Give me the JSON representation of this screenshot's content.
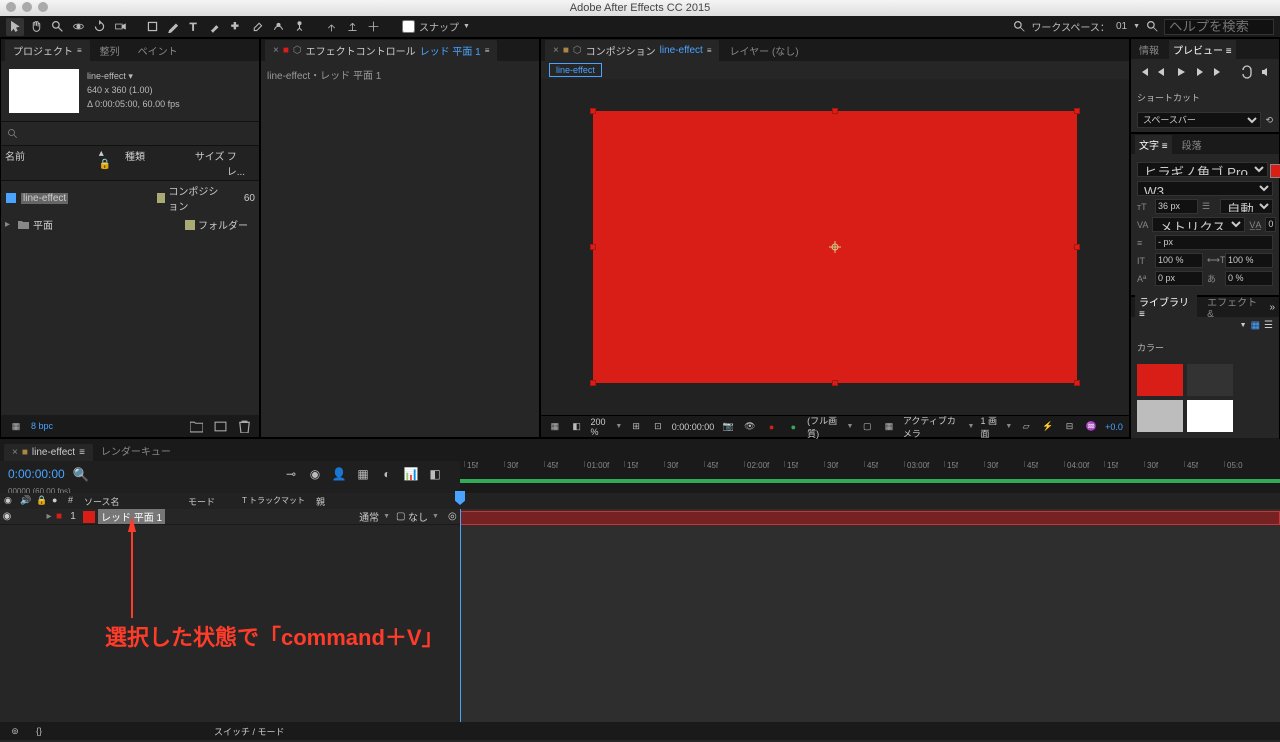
{
  "app": {
    "title": "Adobe After Effects CC 2015"
  },
  "toolbar": {
    "snap_label": "スナップ",
    "workspace_label": "ワークスペース：",
    "workspace_value": "01",
    "search_placeholder": "ヘルプを検索"
  },
  "project": {
    "tab": "プロジェクト",
    "tab2": "整列",
    "tab3": "ペイント",
    "comp_name": "line-effect",
    "comp_dims": "640 x 360 (1.00)",
    "comp_dur": "Δ 0:00:05:00, 60.00 fps",
    "col_name": "名前",
    "col_type": "種類",
    "col_size": "サイズ",
    "col_fre": "フレ...",
    "rows": [
      {
        "name": "line-effect",
        "type": "コンポジション",
        "size": "60"
      },
      {
        "name": "平面",
        "type": "フォルダー",
        "size": ""
      }
    ],
    "bpc": "8 bpc"
  },
  "effect": {
    "tab": "エフェクトコントロール",
    "layer": "レッド 平面 1",
    "path": "line-effect・レッド 平面 1"
  },
  "comp": {
    "tab_prefix": "コンポジション",
    "name": "line-effect",
    "tab_layer": "レイヤー (なし)",
    "chip": "line-effect",
    "zoom": "200 %",
    "time": "0:00:00:00",
    "res": "(フル画質)",
    "camera": "アクティブカメラ",
    "view": "1 画面",
    "offset": "+0.0"
  },
  "right": {
    "info_tab": "情報",
    "preview_tab": "プレビュー",
    "shortcut_label": "ショートカット",
    "shortcut_value": "スペースバー",
    "char_tab": "文字",
    "para_tab": "段落",
    "font": "ヒラギノ角ゴ Pro",
    "font_weight": "W3",
    "font_size": "36 px",
    "leading": "自動",
    "kerning": "メトリクス",
    "tracking": "0",
    "line_spacing": "- px",
    "hscale": "100 %",
    "vscale": "100 %",
    "baseline": "0 px",
    "ratio": "0 %",
    "lib_tab": "ライブラリ",
    "fx_tab": "エフェクト&",
    "colors_label": "カラー",
    "colors": [
      "#d91e18",
      "#333333",
      "#bdbdbd",
      "#ffffff"
    ]
  },
  "timeline": {
    "tab": "line-effect",
    "tab2": "レンダーキュー",
    "time": "0:00:00:00",
    "frame_label": "00000 (60.00 fps)",
    "col_source": "ソース名",
    "col_mode": "モード",
    "col_matte": "T  トラックマット",
    "col_parent": "親",
    "layer": {
      "num": "1",
      "name": "レッド 平面 1",
      "mode": "通常",
      "matte": "なし"
    },
    "switches_label": "スイッチ / モード",
    "ticks": [
      "15f",
      "30f",
      "45f",
      "01:00f",
      "15f",
      "30f",
      "45f",
      "02:00f",
      "15f",
      "30f",
      "45f",
      "03:00f",
      "15f",
      "30f",
      "45f",
      "04:00f",
      "15f",
      "30f",
      "45f",
      "05:0"
    ]
  },
  "annotation": "選択した状態で「command＋V」"
}
